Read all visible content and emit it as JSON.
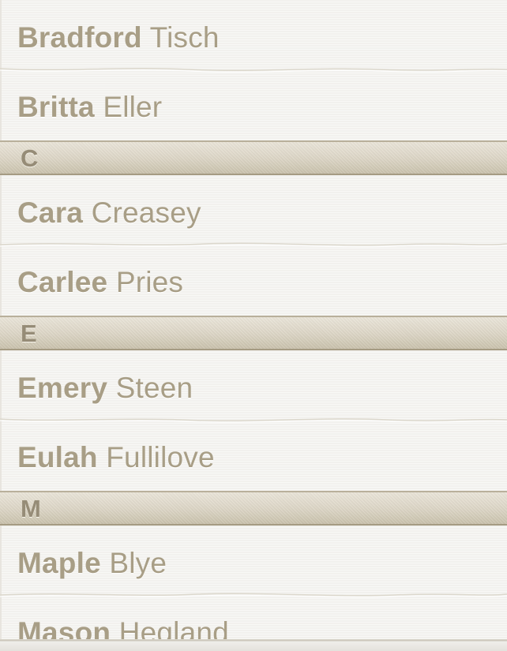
{
  "contact_list": {
    "rows": [
      {
        "first": "Bradford",
        "last": "Tisch"
      },
      {
        "first": "Britta",
        "last": "Eller"
      },
      {
        "first": "Cara",
        "last": "Creasey"
      },
      {
        "first": "Carlee",
        "last": "Pries"
      },
      {
        "first": "Emery",
        "last": "Steen"
      },
      {
        "first": "Eulah",
        "last": "Fullilove"
      },
      {
        "first": "Maple",
        "last": "Blye"
      },
      {
        "first": "Mason",
        "last": "Hegland"
      }
    ],
    "sections": [
      "C",
      "E",
      "M"
    ]
  },
  "colors": {
    "name_text": "#a89e86",
    "section_letter": "#968c77",
    "paper": "#f5f4f1",
    "section_band": "#ddd6c6"
  }
}
